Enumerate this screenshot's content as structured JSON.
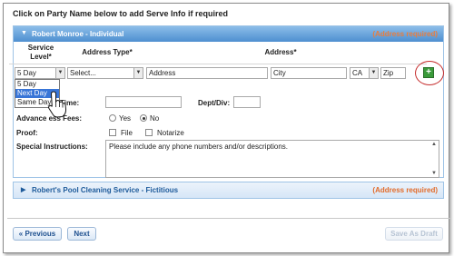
{
  "instruction": "Click on Party Name below to add Serve Info if required",
  "parties": [
    {
      "name": "Robert Monroe - Individual",
      "status": "(Address required)",
      "expanded": true,
      "columns": {
        "service_level": "Service Level*",
        "address_type": "Address Type*",
        "address": "Address*"
      },
      "service_level": {
        "value": "5 Day",
        "options": [
          "5 Day",
          "Next Day",
          "Same Day"
        ],
        "highlighted": "Next Day"
      },
      "address_type": {
        "value": "Select..."
      },
      "address_fields": {
        "address": "Address",
        "city": "City",
        "state": "CA",
        "zip": "Zip"
      },
      "time_label": "Time:",
      "dept_label": "Dept/Div:",
      "advance_fees": {
        "label": "Advance ess Fees:",
        "yes": "Yes",
        "no": "No",
        "selected": "No"
      },
      "proof": {
        "label": "Proof:",
        "file": "File",
        "notarize": "Notarize"
      },
      "special_instructions": {
        "label": "Special Instructions:",
        "value": "Please include any phone numbers and/or descriptions."
      }
    },
    {
      "name": "Robert's Pool Cleaning Service - Fictitious",
      "status": "(Address required)",
      "expanded": false
    }
  ],
  "buttons": {
    "previous": "« Previous",
    "next": "Next",
    "save_draft": "Save As Draft"
  },
  "colors": {
    "header_blue": "#4e8fd0",
    "status_orange": "#e87d3e",
    "add_green": "#3a9a3a",
    "highlight_red": "#c52b2b"
  },
  "icons": {
    "expand": "chevron-down-icon",
    "collapsed": "chevron-right-icon",
    "add": "add-icon",
    "cursor": "hand-cursor-icon"
  }
}
